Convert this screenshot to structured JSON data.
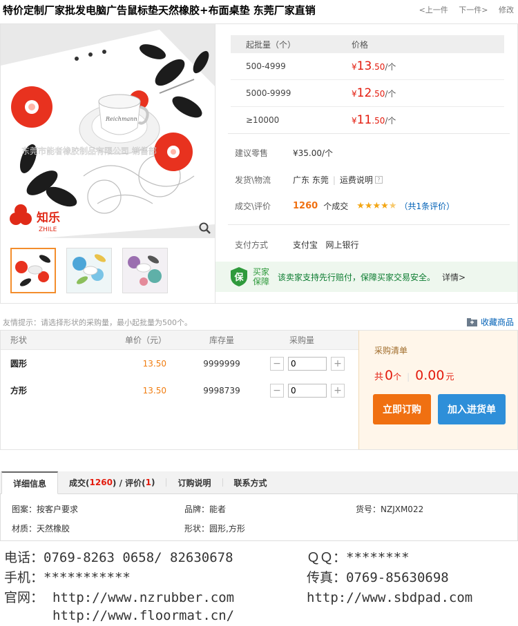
{
  "header": {
    "title": "特价定制厂家批发电脑广告鼠标垫天然橡胶+布面桌垫 东莞厂家直销",
    "prev": "<上一件",
    "next": "下一件>",
    "edit": "修改"
  },
  "gallery": {
    "watermark": "东莞市能者橡胶制品有限公司 销售部",
    "logo_text": "知乐",
    "logo_sub": "ZHILE",
    "cup_text": "Reichmann",
    "thumbnails": [
      "red-black-flower",
      "blue-flower",
      "purple-floral"
    ]
  },
  "price_table": {
    "col_qty": "起批量（个）",
    "col_price": "价格",
    "rows": [
      {
        "qty": "500-4999",
        "currency": "¥",
        "int": "13",
        "dec": ".50",
        "unit": "/个"
      },
      {
        "qty": "5000-9999",
        "currency": "¥",
        "int": "12",
        "dec": ".50",
        "unit": "/个"
      },
      {
        "qty": "≥10000",
        "currency": "¥",
        "int": "11",
        "dec": ".50",
        "unit": "/个"
      }
    ]
  },
  "info": {
    "retail_label": "建议零售",
    "retail_value": "¥35.00/个",
    "shipping_label": "发货\\物流",
    "shipping_origin": "广东 东莞",
    "shipping_note": "运费说明",
    "deals_label": "成交\\评价",
    "deals_count": "1260",
    "deals_suffix": "个成交",
    "rating": 4.5,
    "review_link": "（共1条评价）",
    "payment_label": "支付方式",
    "payment_methods": "支付宝   网上银行"
  },
  "guarantee": {
    "badge_char": "保",
    "badge_line1": "买家",
    "badge_line2": "保障",
    "text": "该卖家支持先行赔付，保障买家交易安全。",
    "detail": "详情>"
  },
  "tips": {
    "text": "友情提示：请选择形状的采购量，最小起批量为500个。",
    "favorite": "收藏商品"
  },
  "purchase": {
    "headers": {
      "shape": "形状",
      "price": "单价（元）",
      "stock": "库存量",
      "qty": "采购量"
    },
    "rows": [
      {
        "shape": "圆形",
        "price": "13.50",
        "stock": "9999999",
        "qty": "0"
      },
      {
        "shape": "方形",
        "price": "13.50",
        "stock": "9998739",
        "qty": "0"
      }
    ],
    "minus": "−",
    "plus": "+"
  },
  "cart": {
    "title": "采购清单",
    "total_prefix": "共",
    "count": "0",
    "count_unit": "个",
    "amount": "0.00",
    "amount_unit": "元",
    "order_button": "立即订购",
    "add_button": "加入进货单"
  },
  "tabs": {
    "detail": "详细信息",
    "deals_prefix": "成交(",
    "deals_count": "1260",
    "deals_mid": ") / 评价(",
    "reviews": "1",
    "deals_suffix": ")",
    "order_notes": "订购说明",
    "contact": "联系方式"
  },
  "attributes": {
    "pattern": "图案：按客户要求",
    "brand": "品牌：能者",
    "sku": "货号：NZJXM022",
    "material": "材质：天然橡胶",
    "shape": "形状：圆形,方形"
  },
  "contact": {
    "phone": "电话：0769-8263 0658/ 82630678",
    "qq": "ＱＱ：********",
    "mobile": "手机：***********",
    "fax": "传真：0769-85630698",
    "site_label": "官网：",
    "site1": "http://www.nzrubber.com",
    "site2": "http://www.sbdpad.com",
    "site3": "http://www.floormat.cn/"
  },
  "colors": {
    "price_red": "#e31b0d",
    "order_orange": "#f07011",
    "cart_blue": "#2e8fd9",
    "guarantee_green": "#0a7b2f"
  }
}
